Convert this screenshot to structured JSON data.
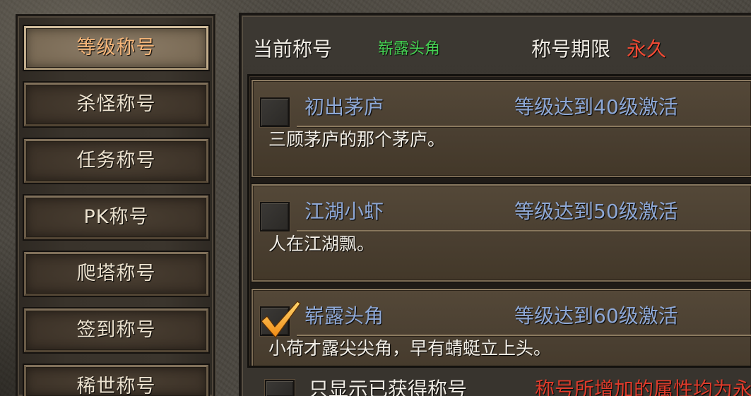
{
  "sidebar": {
    "items": [
      {
        "label": "等级称号",
        "selected": true
      },
      {
        "label": "杀怪称号",
        "selected": false
      },
      {
        "label": "任务称号",
        "selected": false
      },
      {
        "label": "PK称号",
        "selected": false
      },
      {
        "label": "爬塔称号",
        "selected": false
      },
      {
        "label": "签到称号",
        "selected": false
      },
      {
        "label": "稀世称号",
        "selected": false
      }
    ]
  },
  "header": {
    "current_title_label": "当前称号",
    "current_title_value": "崭露头角",
    "duration_label": "称号期限",
    "duration_value": "永久"
  },
  "titles": [
    {
      "name": "初出茅庐",
      "requirement": "等级达到40级激活",
      "description": "三顾茅庐的那个茅庐。",
      "checked": false
    },
    {
      "name": "江湖小虾",
      "requirement": "等级达到50级激活",
      "description": "人在江湖飘。",
      "checked": false
    },
    {
      "name": "崭露头角",
      "requirement": "等级达到60级激活",
      "description": "小荷才露尖尖角，早有蜻蜓立上头。",
      "checked": true
    }
  ],
  "footer": {
    "owned_only_label": "只显示已获得称号",
    "owned_only_checked": false,
    "notice": "称号所增加的属性均为永"
  },
  "colors": {
    "selected_tab_text": "#f6b679",
    "tab_text": "#ece2cf",
    "header_text": "#f1ede5",
    "current_title_value": "#46d253",
    "duration_value": "#f04a34",
    "title_name": "#8ea8d6",
    "requirement": "#8ea8d6",
    "description": "#f2eee6",
    "notice": "#de3b2b",
    "checkmark": "#f08a14"
  }
}
